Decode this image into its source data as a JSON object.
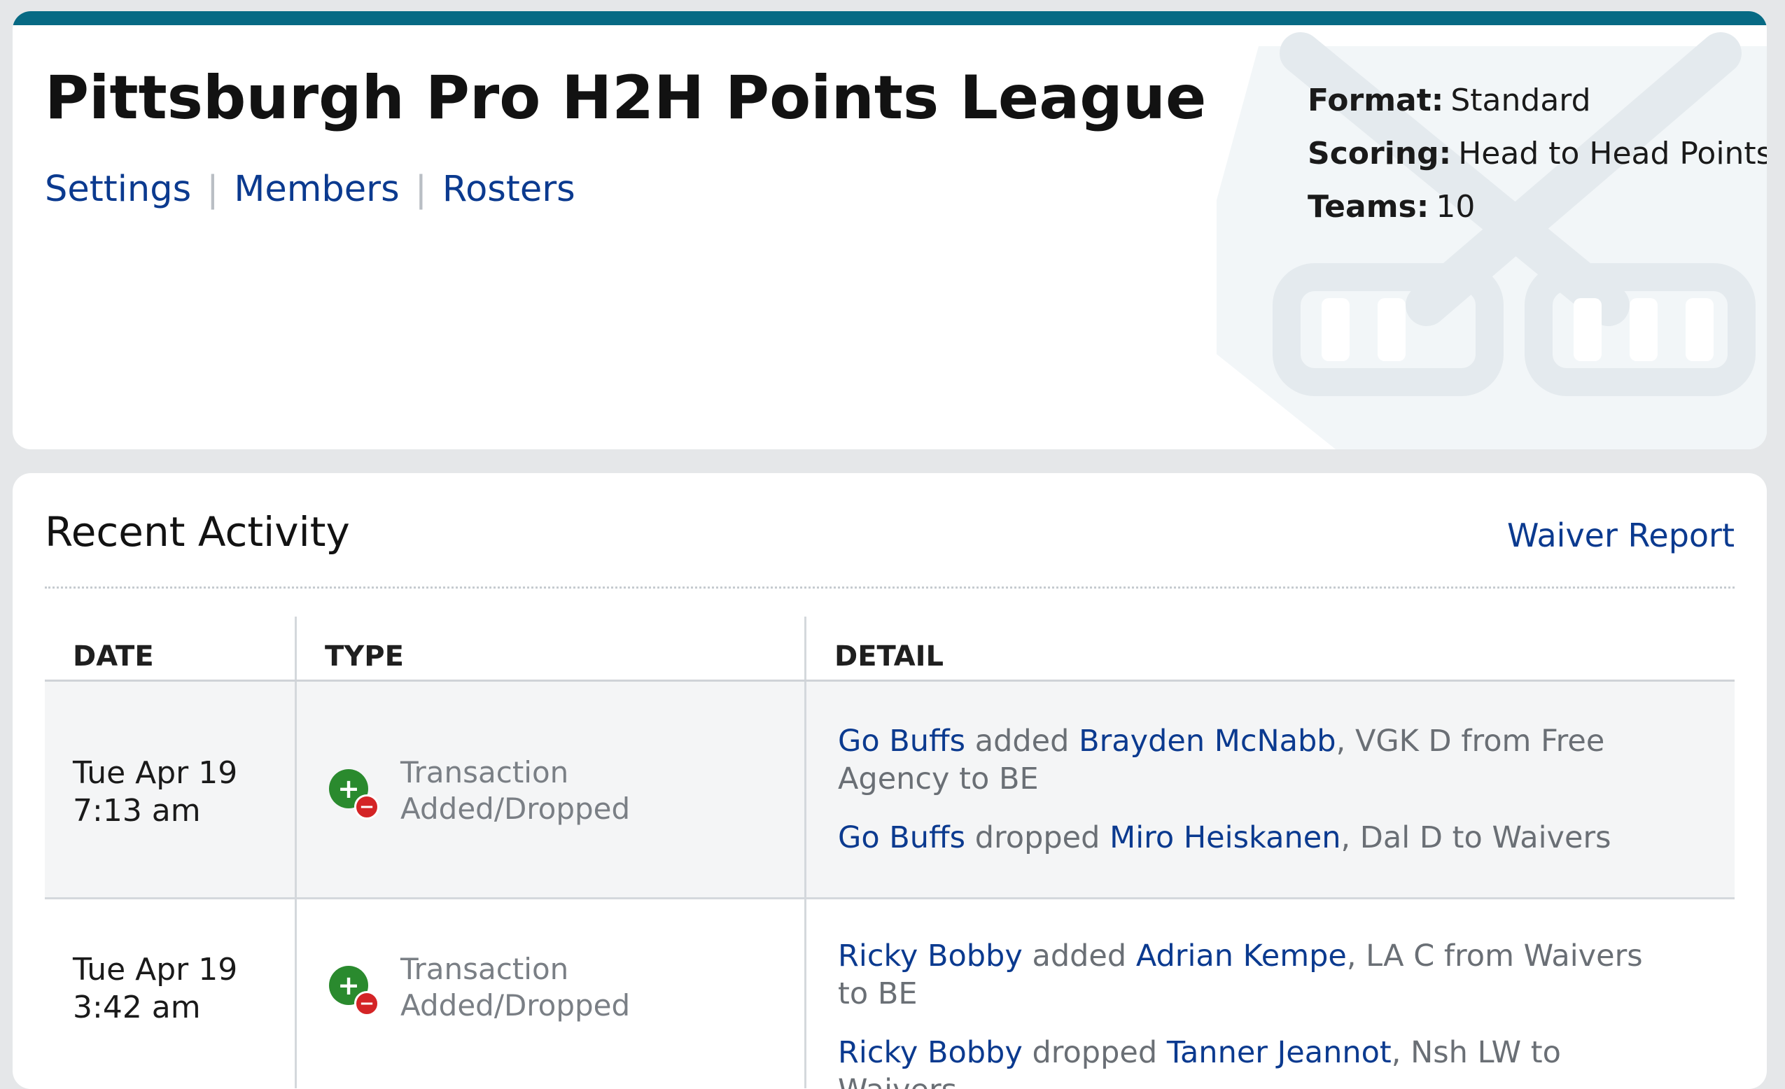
{
  "league": {
    "title": "Pittsburgh Pro H2H Points League",
    "nav": [
      "Settings",
      "Members",
      "Rosters"
    ],
    "info": [
      {
        "label": "Format:",
        "value": "Standard"
      },
      {
        "label": "Scoring:",
        "value": "Head to Head Points"
      },
      {
        "label": "Teams:",
        "value": "10"
      }
    ],
    "accent_color": "#076a84"
  },
  "activity": {
    "title": "Recent Activity",
    "waiver_report": "Waiver Report",
    "columns": [
      "DATE",
      "TYPE",
      "DETAIL"
    ],
    "rows": [
      {
        "date": "Tue Apr 19",
        "time": "7:13 am",
        "type_line1": "Transaction",
        "type_line2": "Added/Dropped",
        "icon": "add-drop-icon",
        "details": [
          {
            "team": "Go Buffs",
            "action": " added ",
            "player": "Brayden McNabb",
            "rest": ", VGK D from Free Agency to BE"
          },
          {
            "team": "Go Buffs",
            "action": " dropped ",
            "player": "Miro Heiskanen",
            "rest": ", Dal D to Waivers"
          }
        ]
      },
      {
        "date": "Tue Apr 19",
        "time": "3:42 am",
        "type_line1": "Transaction",
        "type_line2": "Added/Dropped",
        "icon": "add-drop-icon",
        "details": [
          {
            "team": "Ricky Bobby",
            "action": " added ",
            "player": "Adrian Kempe",
            "rest": ", LA C from Waivers to BE"
          },
          {
            "team": "Ricky Bobby",
            "action": " dropped ",
            "player": "Tanner Jeannot",
            "rest": ", Nsh LW to Waivers"
          }
        ]
      }
    ]
  }
}
